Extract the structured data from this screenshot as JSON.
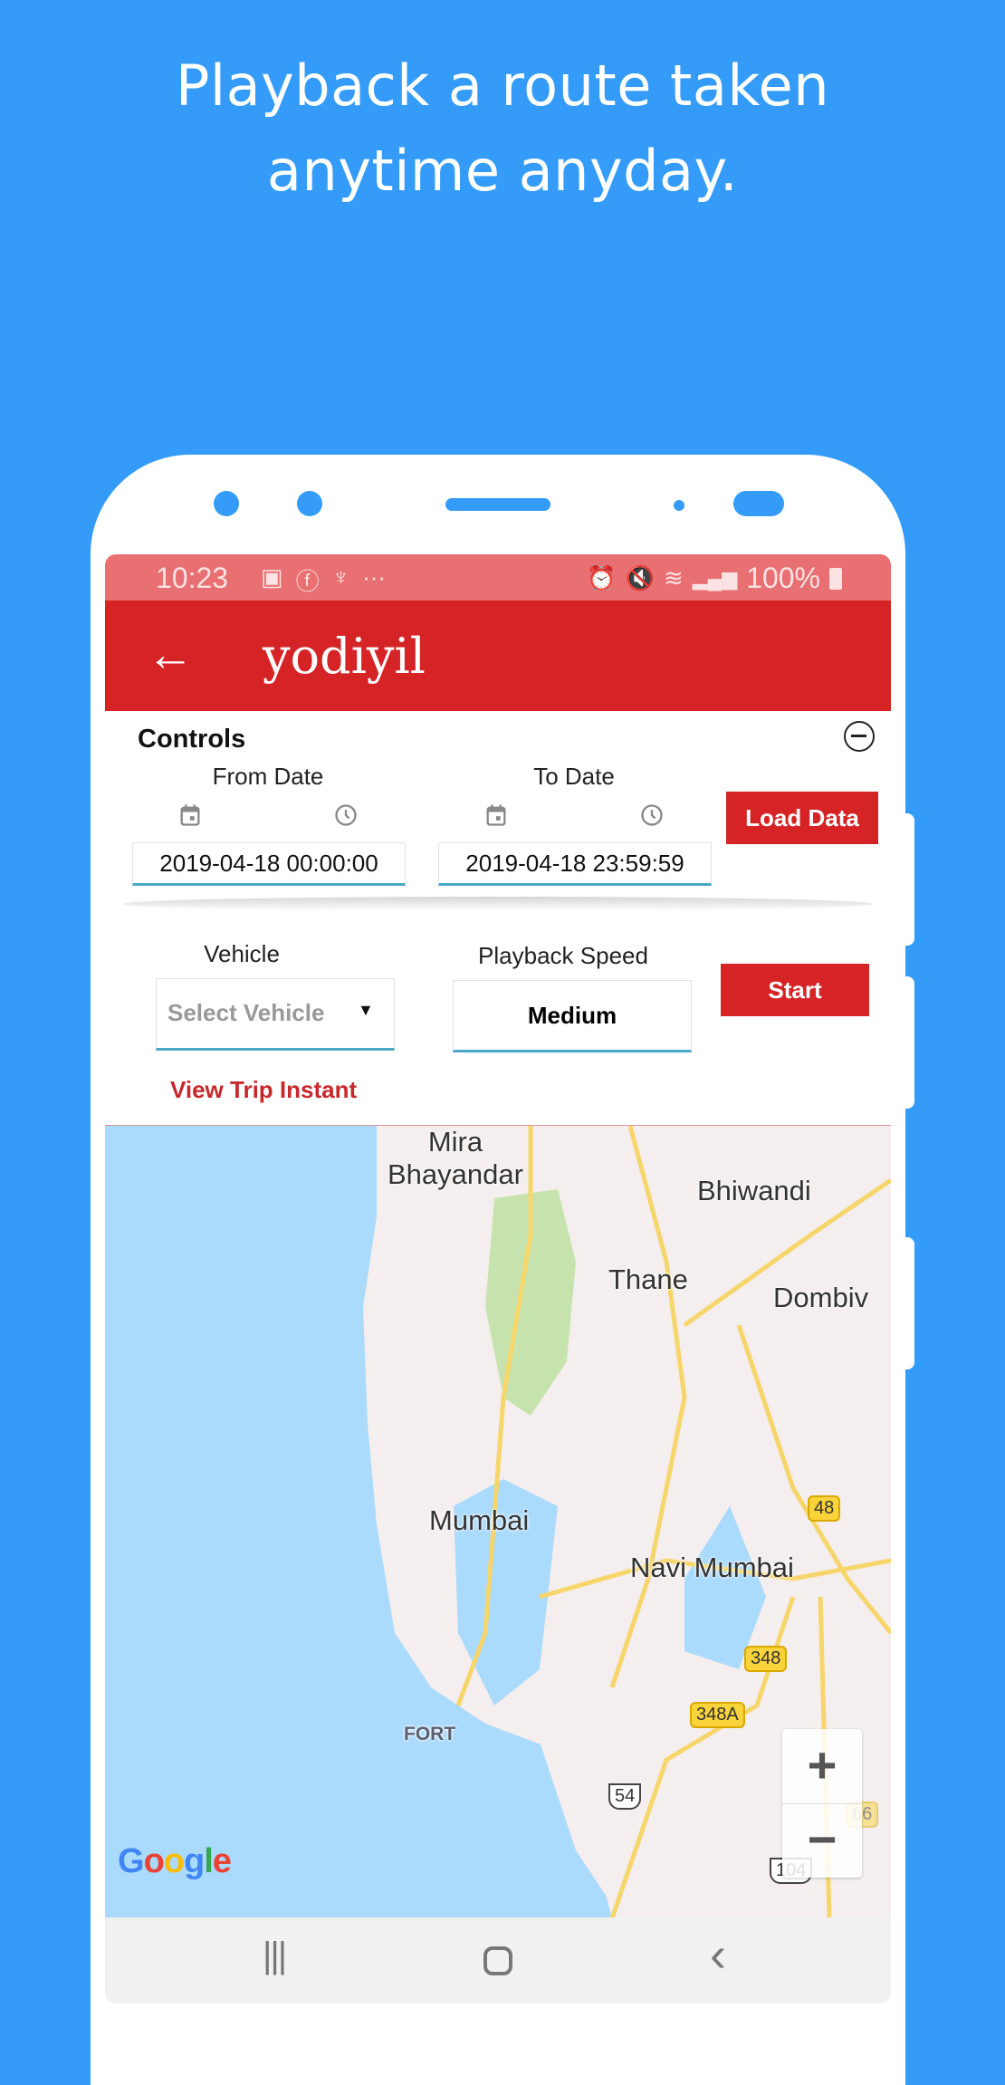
{
  "headline": {
    "line1": "Playback a route taken",
    "line2": "anytime anyday."
  },
  "status_bar": {
    "time": "10:23",
    "battery": "100%",
    "left_icons": [
      "image-icon",
      "fi-icon",
      "gesture-icon",
      "more-dots-icon"
    ],
    "right_icons": [
      "alarm-icon",
      "mute-icon",
      "wifi-icon",
      "signal-icon",
      "battery-icon"
    ]
  },
  "app_bar": {
    "back_icon": "arrow-left-icon",
    "title": "yodiyil"
  },
  "controls": {
    "title": "Controls",
    "collapse_icon": "minus-circle-icon",
    "from_date": {
      "label": "From Date",
      "value": "2019-04-18 00:00:00"
    },
    "to_date": {
      "label": "To Date",
      "value": "2019-04-18 23:59:59"
    },
    "load_button": "Load Data",
    "vehicle": {
      "label": "Vehicle",
      "placeholder": "Select Vehicle"
    },
    "playback_speed": {
      "label": "Playback Speed",
      "value": "Medium"
    },
    "start_button": "Start",
    "view_trip_link": "View Trip Instant"
  },
  "map": {
    "labels": [
      "Mira\nBhayandar",
      "Bhiwandi",
      "Thane",
      "Dombiv",
      "Mumbai",
      "Navi Mumbai",
      "FORT"
    ],
    "shields": [
      "48",
      "348",
      "348A",
      "54",
      "66",
      "104"
    ],
    "zoom_in": "+",
    "zoom_out": "−",
    "attribution": "Google"
  },
  "nav_bar": {
    "recents": "|||",
    "home": "▢",
    "back": "‹"
  },
  "colors": {
    "background": "#349cf8",
    "primary": "#d62426",
    "status_bar": "#e86f72",
    "link": "#c8282b",
    "underline": "#4aa8c4"
  }
}
